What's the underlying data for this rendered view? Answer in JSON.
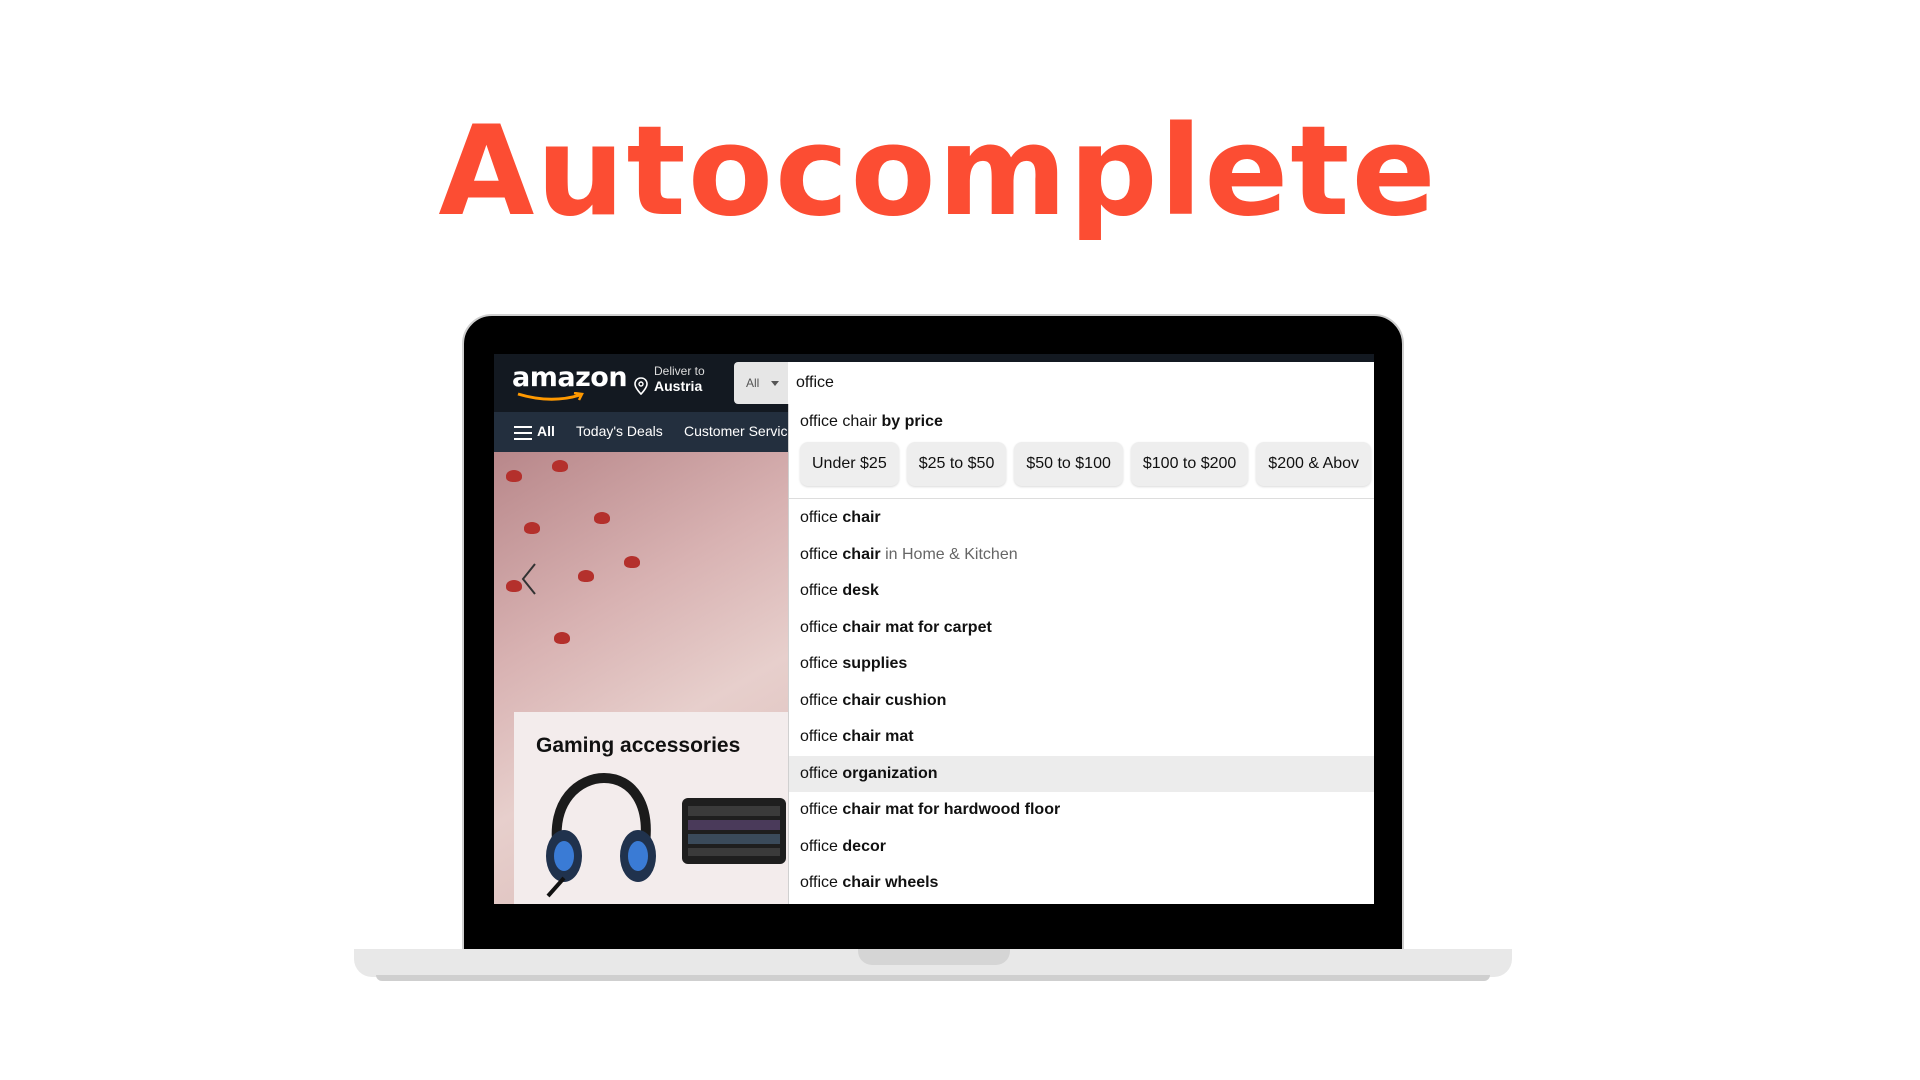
{
  "headline": "Autocomplete",
  "colors": {
    "headline": "#fc4d33",
    "amazon_nav": "#131921",
    "amazon_nav_secondary": "#232f3e",
    "highlight_row": "#ececec"
  },
  "amazon": {
    "logo": "amazon",
    "deliver_line1": "Deliver to",
    "deliver_line2": "Austria",
    "search_category": "All",
    "search_value": "office",
    "nav_items": {
      "all": "All",
      "todays_deals": "Today's Deals",
      "customer_service": "Customer Servic"
    },
    "card_title": "Gaming accessories"
  },
  "autocomplete": {
    "header": {
      "prefix": "office chair ",
      "suffix": "by price"
    },
    "price_chips": [
      "Under $25",
      "$25 to $50",
      "$50 to $100",
      "$100 to $200",
      "$200 & Abov"
    ],
    "suggestions": [
      {
        "prefix": "office ",
        "suffix": "chair",
        "dept": ""
      },
      {
        "prefix": "office ",
        "suffix": "chair",
        "dept": " in Home & Kitchen"
      },
      {
        "prefix": "office ",
        "suffix": "desk",
        "dept": ""
      },
      {
        "prefix": "office ",
        "suffix": "chair mat for carpet",
        "dept": ""
      },
      {
        "prefix": "office ",
        "suffix": "supplies",
        "dept": ""
      },
      {
        "prefix": "office ",
        "suffix": "chair cushion",
        "dept": ""
      },
      {
        "prefix": "office ",
        "suffix": "chair mat",
        "dept": ""
      },
      {
        "prefix": "office ",
        "suffix": "organization",
        "dept": "",
        "highlighted": true
      },
      {
        "prefix": "office ",
        "suffix": "chair mat for hardwood floor",
        "dept": ""
      },
      {
        "prefix": "office ",
        "suffix": "decor",
        "dept": ""
      },
      {
        "prefix": "office ",
        "suffix": "chair wheels",
        "dept": ""
      }
    ]
  }
}
